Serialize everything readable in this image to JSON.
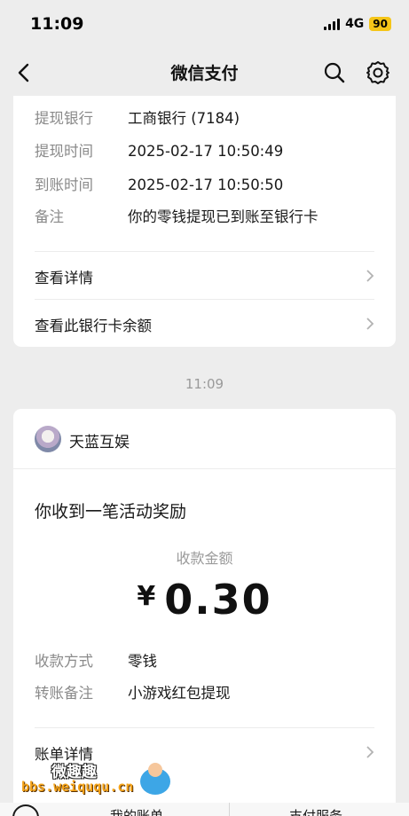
{
  "status_bar": {
    "time": "11:09",
    "network": "4G",
    "battery": "90"
  },
  "nav": {
    "title": "微信支付"
  },
  "withdraw_card": {
    "rows": [
      {
        "label": "提现银行",
        "value": "工商银行 (7184)"
      },
      {
        "label": "提现时间",
        "value": "2025-02-17 10:50:49"
      },
      {
        "label": "到账时间",
        "value": "2025-02-17 10:50:50"
      },
      {
        "label": "备注",
        "value": "你的零钱提现已到账至银行卡"
      }
    ],
    "links": [
      "查看详情",
      "查看此银行卡余额"
    ]
  },
  "time_separator": "11:09",
  "reward_card": {
    "sender": "天蓝互娱",
    "title": "你收到一笔活动奖励",
    "amount_label": "收款金额",
    "currency": "¥",
    "amount": "0.30",
    "rows": [
      {
        "label": "收款方式",
        "value": "零钱"
      },
      {
        "label": "转账备注",
        "value": "小游戏红包提现"
      }
    ],
    "detail_link": "账单详情"
  },
  "watermark": {
    "name": "微趣趣",
    "url": "bbs.weiququ.cn"
  },
  "bottom_tabs": {
    "left": "我的账单",
    "right": "支付服务"
  }
}
